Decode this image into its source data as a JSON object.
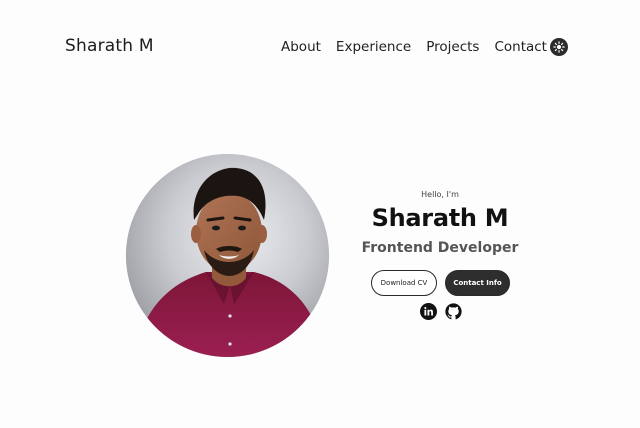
{
  "nav": {
    "logo": "Sharath M",
    "links": [
      {
        "label": "About"
      },
      {
        "label": "Experience"
      },
      {
        "label": "Projects"
      },
      {
        "label": "Contact"
      }
    ],
    "theme_icon": "sun-icon"
  },
  "hero": {
    "greeting": "Hello, I'm",
    "name": "Sharath M",
    "role": "Frontend Developer",
    "buttons": {
      "download_cv": "Download CV",
      "contact_info": "Contact Info"
    },
    "socials": [
      {
        "icon": "linkedin-icon"
      },
      {
        "icon": "github-icon"
      }
    ],
    "profile_image": "profile-photo"
  },
  "colors": {
    "background": "#fdfdfd",
    "text": "#111111",
    "accent": "#2e2e2e",
    "subtitle": "#555555",
    "shirt": "#8a1a45"
  }
}
